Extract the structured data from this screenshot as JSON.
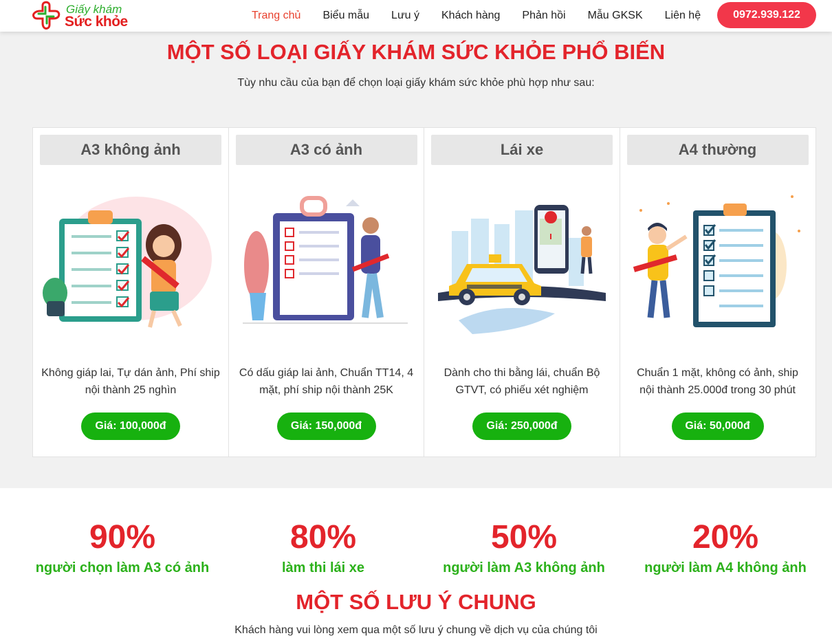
{
  "header": {
    "logo_line1": "Giấy khám",
    "logo_line2": "Sức khỏe",
    "nav": [
      "Trang chủ",
      "Biểu mẫu",
      "Lưu ý",
      "Khách hàng",
      "Phản hồi",
      "Mẫu GKSK",
      "Liên hệ"
    ],
    "active_nav": "Trang chủ",
    "phone": "0972.939.122",
    "colors": {
      "brand_red": "#e3242b",
      "brand_green": "#2eae2e",
      "phone_button": "#f2374a"
    }
  },
  "products": {
    "title": "MỘT SỐ LOẠI GIẤY KHÁM SỨC KHỎE PHỔ BIẾN",
    "subtitle": "Tùy nhu cầu của bạn để chọn loại giấy khám sức khỏe phù hợp như sau:",
    "cards": [
      {
        "title": "A3 không ảnh",
        "description": "Không giáp lai, Tự dán ảnh, Phí ship nội thành 25 nghìn",
        "price": "Giá: 100,000đ",
        "icon": "clipboard-girl-illustration"
      },
      {
        "title": "A3 có ảnh",
        "description": "Có dấu giáp lai ảnh, Chuẩn TT14, 4 mặt, phí ship nội thành 25K",
        "price": "Giá: 150,000đ",
        "icon": "clipboard-man-illustration"
      },
      {
        "title": "Lái xe",
        "description": "Dành cho thi bằng lái, chuẩn Bộ GTVT, có phiếu xét nghiệm",
        "price": "Giá: 250,000đ",
        "icon": "taxi-phone-illustration"
      },
      {
        "title": "A4 thường",
        "description": "Chuẩn 1 mặt, không có ảnh, ship nội thành 25.000đ trong 30 phút",
        "price": "Giá: 50,000đ",
        "icon": "checklist-man-illustration"
      }
    ],
    "price_button_color": "#17b10f"
  },
  "stats": [
    {
      "value": "90%",
      "label": "người chọn làm A3 có ảnh"
    },
    {
      "value": "80%",
      "label": "làm thi lái xe"
    },
    {
      "value": "50%",
      "label": "người làm A3 không ảnh"
    },
    {
      "value": "20%",
      "label": "người làm A4 không ảnh"
    }
  ],
  "notes": {
    "title": "MỘT SỐ LƯU Ý CHUNG",
    "subtitle": "Khách hàng vui lòng xem qua một số lưu ý chung về dịch vụ của chúng tôi"
  }
}
